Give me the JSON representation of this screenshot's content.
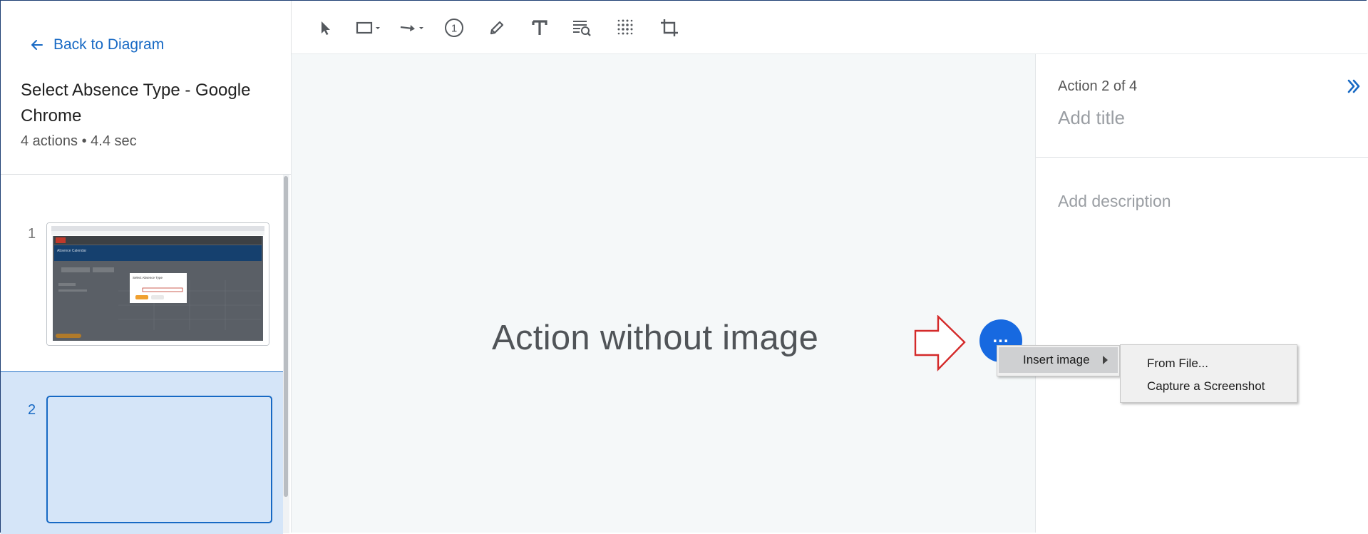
{
  "sidebar": {
    "back_label": "Back to Diagram",
    "title": "Select Absence Type - Google Chrome",
    "meta": "4 actions • 4.4 sec",
    "actions": [
      {
        "number": "1"
      },
      {
        "number": "2"
      }
    ],
    "thumbnail_1": {
      "dialog_title": "Select Absence Type",
      "app_heading": "Absence Calendar"
    }
  },
  "toolbar": {
    "tools": [
      "select-icon",
      "rectangle-icon",
      "arrow-line-icon",
      "step-number-icon",
      "pen-icon",
      "text-icon",
      "magnify-text-icon",
      "blur-icon",
      "crop-icon"
    ]
  },
  "canvas": {
    "placeholder": "Action without image",
    "more_button_label": "..."
  },
  "context_menu": {
    "insert_image": "Insert image",
    "submenu": [
      "From File...",
      "Capture a Screenshot"
    ]
  },
  "details": {
    "action_count": "Action 2 of 4",
    "title_placeholder": "Add title",
    "description_placeholder": "Add description"
  },
  "colors": {
    "accent": "#1769c4",
    "button": "#1769e0",
    "selected_bg": "#d5e5f8",
    "arrow_red": "#d42a2a"
  }
}
